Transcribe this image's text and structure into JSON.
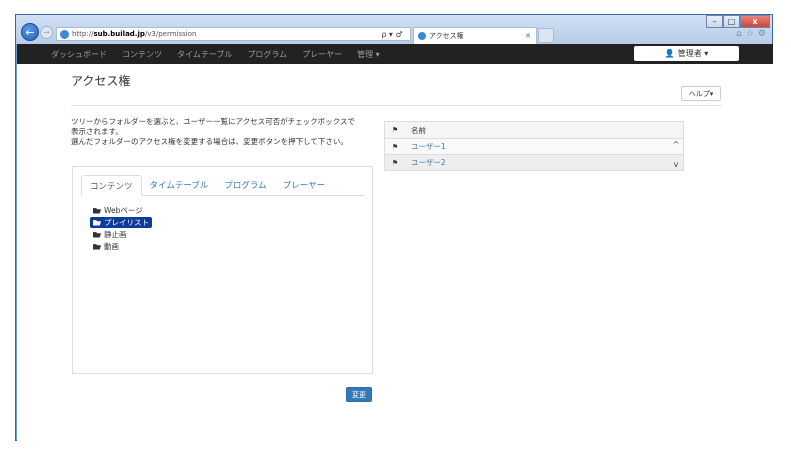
{
  "browser": {
    "url_prefix": "http://",
    "url_host": "sub.builad.jp",
    "url_path": "/v3/permission",
    "address_tools": "ρ ▾ ♂",
    "tab_title": "アクセス権",
    "window_buttons": {
      "minimize": "–",
      "maximize": "□",
      "close": "x"
    },
    "right_icons": [
      "⌂",
      "☆",
      "⚙"
    ]
  },
  "navbar": {
    "items": [
      "ダッシュボード",
      "コンテンツ",
      "タイムテーブル",
      "プログラム",
      "プレーヤー",
      "管理 ▾"
    ],
    "user_label": "管理者 ▾",
    "user_icon": "👤"
  },
  "page": {
    "title": "アクセス権",
    "help_label": "ヘルプ▾",
    "instructions_line1": "ツリーからフォルダーを選ぶと、ユーザー一覧にアクセス可否がチェックボックスで",
    "instructions_line2": "表示されます。",
    "instructions_line3": "選んだフォルダーのアクセス権を変更する場合は、変更ボタンを押下して下さい。",
    "change_button": "変更"
  },
  "tabs": [
    "コンテンツ",
    "タイムテーブル",
    "プログラム",
    "プレーヤー"
  ],
  "tree": [
    {
      "label": "Webページ",
      "selected": false
    },
    {
      "label": "プレイリスト",
      "selected": true
    },
    {
      "label": "静止画",
      "selected": false
    },
    {
      "label": "動画",
      "selected": false
    }
  ],
  "user_table": {
    "header_flag": "⚑",
    "header_name": "名前",
    "rows": [
      {
        "flag": "⚑",
        "name": "ユーザー1"
      },
      {
        "flag": "⚑",
        "name": "ユーザー2"
      }
    ],
    "scroll_up": "^",
    "scroll_down": "v"
  }
}
